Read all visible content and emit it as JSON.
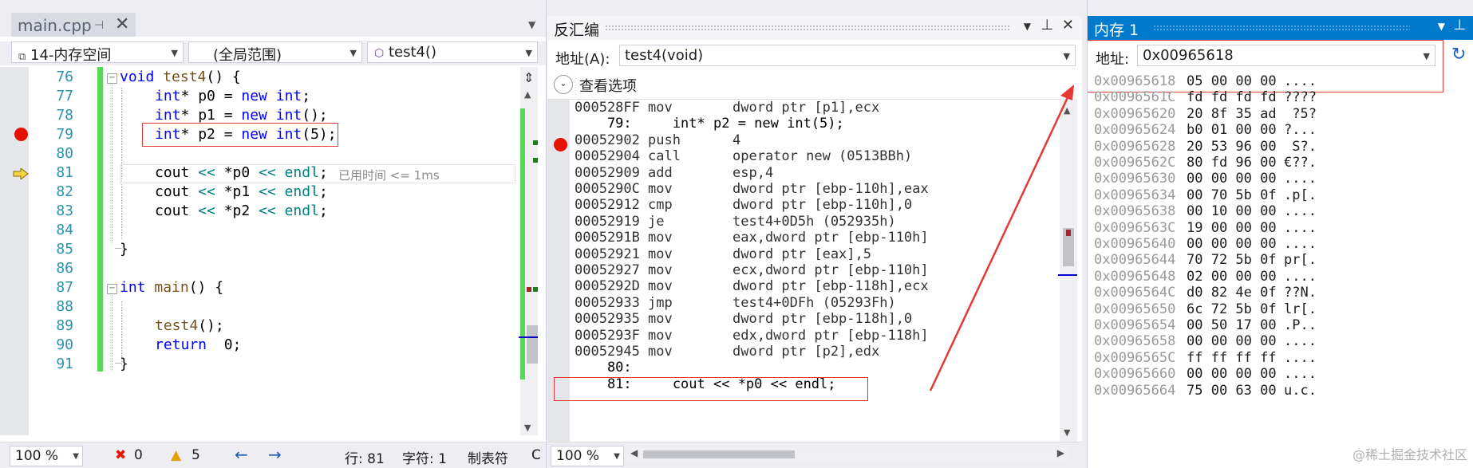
{
  "editor": {
    "tab": {
      "name": "main.cpp",
      "pin": "⊣",
      "close": "✕"
    },
    "nav": {
      "project": "14-内存空间",
      "scope": "(全局范围)",
      "member": "test4()"
    },
    "lines": [
      {
        "num": "76",
        "text": "void test4() {"
      },
      {
        "num": "77",
        "text": "int* p0 = new int;"
      },
      {
        "num": "78",
        "text": "int* p1 = new int();"
      },
      {
        "num": "79",
        "text": "int* p2 = new int(5);"
      },
      {
        "num": "80",
        "text": ""
      },
      {
        "num": "81",
        "text": "cout << *p0 << endl;"
      },
      {
        "num": "82",
        "text": "cout << *p1 << endl;"
      },
      {
        "num": "83",
        "text": "cout << *p2 << endl;"
      },
      {
        "num": "84",
        "text": ""
      },
      {
        "num": "85",
        "text": "}"
      },
      {
        "num": "86",
        "text": ""
      },
      {
        "num": "87",
        "text": "int main() {"
      },
      {
        "num": "88",
        "text": ""
      },
      {
        "num": "89",
        "text": "test4();"
      },
      {
        "num": "90",
        "text": "return  0;"
      },
      {
        "num": "91",
        "text": "}"
      }
    ],
    "elapsed_hint": "已用时间 <= 1ms",
    "status": {
      "zoom": "100 %",
      "errors": "0",
      "warnings": "5",
      "line": "行: 81",
      "char": "字符: 1",
      "tab_mode": "制表符",
      "trailing": "C"
    }
  },
  "disasm": {
    "title": "反汇编",
    "address_label": "地址(A):",
    "address_value": "test4(void)",
    "view_options": "查看选项",
    "rows": [
      {
        "addr": "000528FF",
        "op": "mov",
        "args": "dword ptr [p1],ecx"
      },
      {
        "src": "    79:     int* p2 = new int(5);"
      },
      {
        "addr": "00052902",
        "op": "push",
        "args": "4"
      },
      {
        "addr": "00052904",
        "op": "call",
        "args": "operator new (0513BBh)"
      },
      {
        "addr": "00052909",
        "op": "add",
        "args": "esp,4"
      },
      {
        "addr": "0005290C",
        "op": "mov",
        "args": "dword ptr [ebp-110h],eax"
      },
      {
        "addr": "00052912",
        "op": "cmp",
        "args": "dword ptr [ebp-110h],0"
      },
      {
        "addr": "00052919",
        "op": "je",
        "args": "test4+0D5h (052935h)"
      },
      {
        "addr": "0005291B",
        "op": "mov",
        "args": "eax,dword ptr [ebp-110h]"
      },
      {
        "addr": "00052921",
        "op": "mov",
        "args": "dword ptr [eax],5"
      },
      {
        "addr": "00052927",
        "op": "mov",
        "args": "ecx,dword ptr [ebp-110h]"
      },
      {
        "addr": "0005292D",
        "op": "mov",
        "args": "dword ptr [ebp-118h],ecx"
      },
      {
        "addr": "00052933",
        "op": "jmp",
        "args": "test4+0DFh (05293Fh)"
      },
      {
        "addr": "00052935",
        "op": "mov",
        "args": "dword ptr [ebp-118h],0"
      },
      {
        "addr": "0005293F",
        "op": "mov",
        "args": "edx,dword ptr [ebp-118h]"
      },
      {
        "addr": "00052945",
        "op": "mov",
        "args": "dword ptr [p2],edx"
      },
      {
        "src": "    80:"
      },
      {
        "src": "    81:     cout << *p0 << endl;"
      }
    ],
    "zoom": "100 %"
  },
  "memory": {
    "title": "内存 1",
    "address_label": "地址:",
    "address_value": "0x00965618",
    "rows": [
      {
        "addr": "0x00965618",
        "hex": "05 00 00 00",
        "ascii": "...."
      },
      {
        "addr": "0x0096561C",
        "hex": "fd fd fd fd",
        "ascii": "????"
      },
      {
        "addr": "0x00965620",
        "hex": "20 8f 35 ad",
        "ascii": " ?5?"
      },
      {
        "addr": "0x00965624",
        "hex": "b0 01 00 00",
        "ascii": "?..."
      },
      {
        "addr": "0x00965628",
        "hex": "20 53 96 00",
        "ascii": " S?."
      },
      {
        "addr": "0x0096562C",
        "hex": "80 fd 96 00",
        "ascii": "€??."
      },
      {
        "addr": "0x00965630",
        "hex": "00 00 00 00",
        "ascii": "...."
      },
      {
        "addr": "0x00965634",
        "hex": "00 70 5b 0f",
        "ascii": ".p[."
      },
      {
        "addr": "0x00965638",
        "hex": "00 10 00 00",
        "ascii": "...."
      },
      {
        "addr": "0x0096563C",
        "hex": "19 00 00 00",
        "ascii": "...."
      },
      {
        "addr": "0x00965640",
        "hex": "00 00 00 00",
        "ascii": "...."
      },
      {
        "addr": "0x00965644",
        "hex": "70 72 5b 0f",
        "ascii": "pr[."
      },
      {
        "addr": "0x00965648",
        "hex": "02 00 00 00",
        "ascii": "...."
      },
      {
        "addr": "0x0096564C",
        "hex": "d0 82 4e 0f",
        "ascii": "??N."
      },
      {
        "addr": "0x00965650",
        "hex": "6c 72 5b 0f",
        "ascii": "lr[."
      },
      {
        "addr": "0x00965654",
        "hex": "00 50 17 00",
        "ascii": ".P.."
      },
      {
        "addr": "0x00965658",
        "hex": "00 00 00 00",
        "ascii": "...."
      },
      {
        "addr": "0x0096565C",
        "hex": "ff ff ff ff",
        "ascii": "...."
      },
      {
        "addr": "0x00965660",
        "hex": "00 00 00 00",
        "ascii": "...."
      },
      {
        "addr": "0x00965664",
        "hex": "75 00 63 00",
        "ascii": "u.c."
      }
    ],
    "watermark": "@稀土掘金技术社区"
  },
  "colors": {
    "accent": "#007acc",
    "breakpoint": "#e51400",
    "annotation": "#e53935"
  }
}
